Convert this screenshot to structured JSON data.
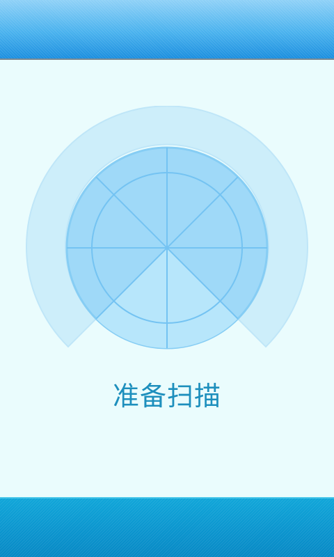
{
  "status": {
    "text": "准备扫描"
  },
  "radar": {
    "icon": "radar-scan-icon",
    "colors": {
      "outer_arc": "#cdeefa",
      "disc_fill": "#9fd9f8",
      "active_sector": "#b7e6fb",
      "lines": "#74c3f2"
    }
  },
  "bars": {
    "top_color": "#49b2ee",
    "bottom_color": "#0a93cd"
  }
}
